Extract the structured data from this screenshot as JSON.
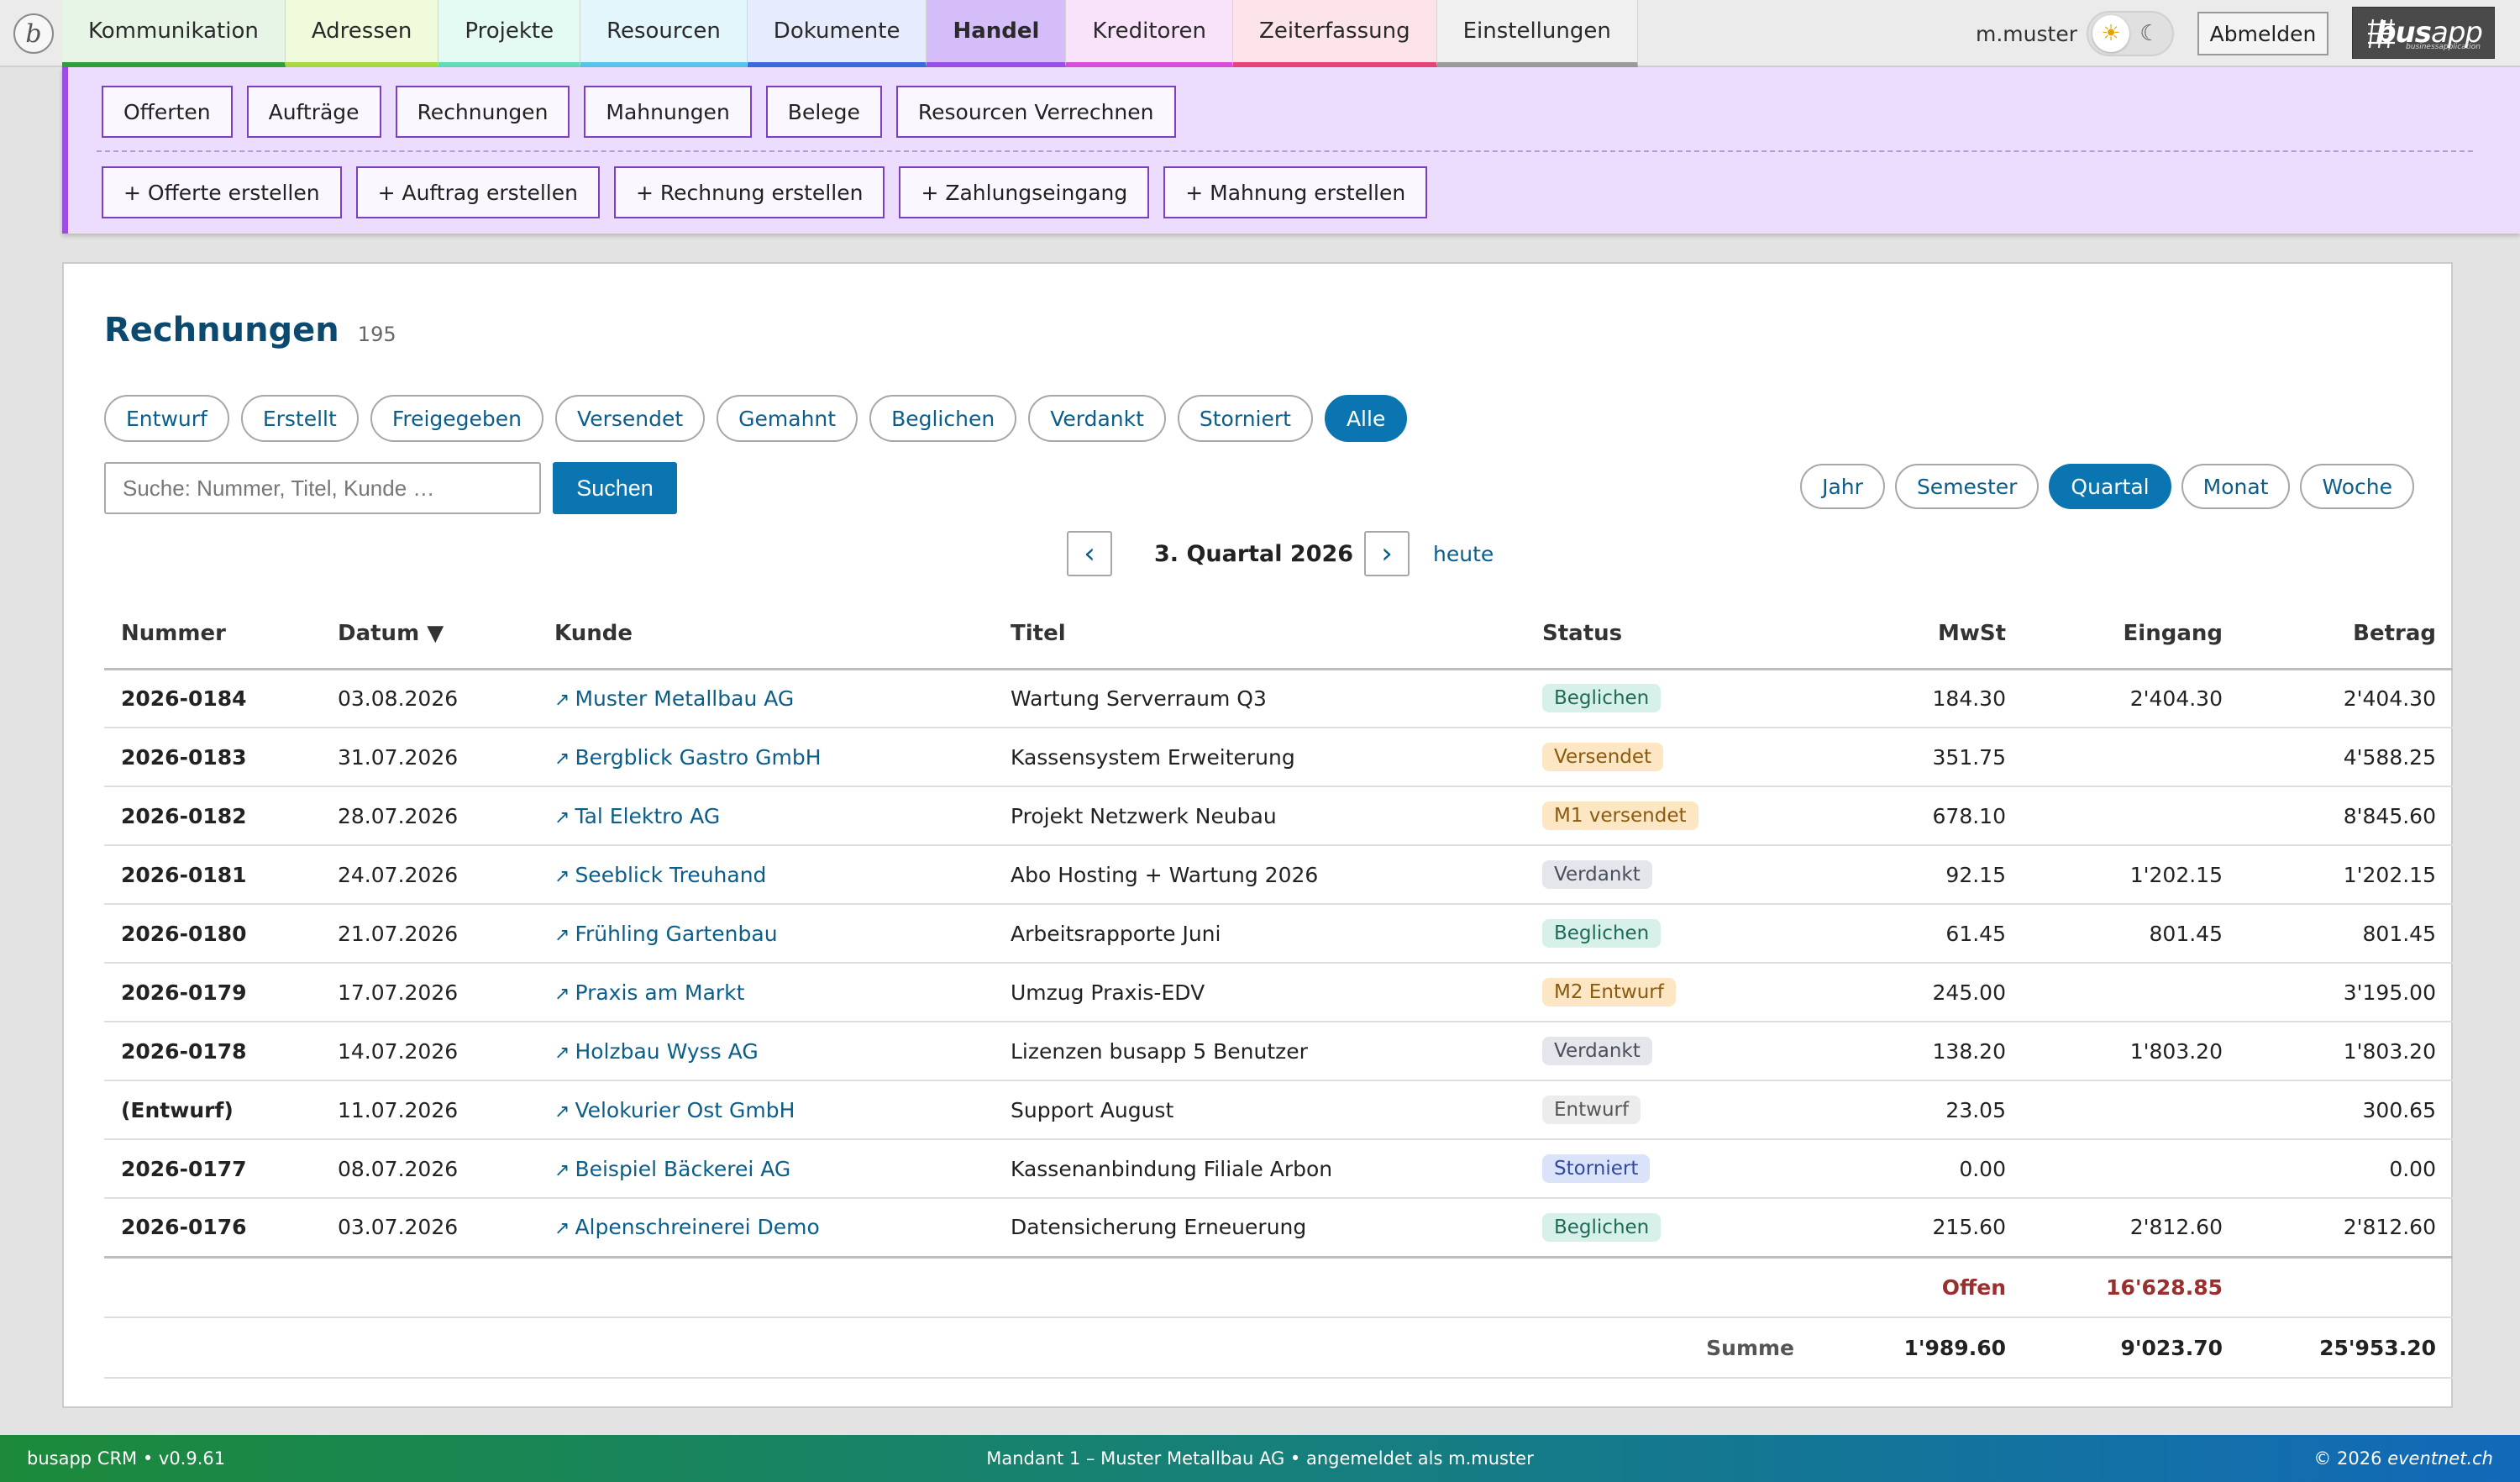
{
  "nav": {
    "logo_letter": "b",
    "tabs": [
      {
        "label": "Kommunikation",
        "color": "#e6f5e6",
        "accent": "#2e9e3f"
      },
      {
        "label": "Adressen",
        "color": "#f0fbdc",
        "accent": "#a5d93f"
      },
      {
        "label": "Projekte",
        "color": "#e3fbf3",
        "accent": "#5fdcb8"
      },
      {
        "label": "Resourcen",
        "color": "#e3f6fb",
        "accent": "#55c4e8"
      },
      {
        "label": "Dokumente",
        "color": "#e6ecfe",
        "accent": "#3a6ae0"
      },
      {
        "label": "Handel",
        "color": "#d4bdf8",
        "accent": "#9b4ee6"
      },
      {
        "label": "Kreditoren",
        "color": "#f9e3fb",
        "accent": "#d94ed9"
      },
      {
        "label": "Zeiterfassung",
        "color": "#fde4ea",
        "accent": "#e8437a"
      },
      {
        "label": "Einstellungen",
        "color": "#f0f0f0",
        "accent": "#9a9a9a"
      }
    ],
    "active_tab": "Handel",
    "user": "m.muster",
    "logout_label": "Abmelden",
    "brand": {
      "bold": "bus",
      "light": "app",
      "sub": "businessapplication"
    }
  },
  "subnav": {
    "row1": [
      "Offerten",
      "Aufträge",
      "Rechnungen",
      "Mahnungen",
      "Belege",
      "Resourcen Verrechnen"
    ],
    "row2": [
      "+ Offerte erstellen",
      "+ Auftrag erstellen",
      "+ Rechnung erstellen",
      "+ Zahlungseingang",
      "+ Mahnung erstellen"
    ]
  },
  "page": {
    "title": "Rechnungen",
    "count": "195"
  },
  "filters": {
    "status": [
      "Entwurf",
      "Erstellt",
      "Freigegeben",
      "Versendet",
      "Gemahnt",
      "Beglichen",
      "Verdankt",
      "Storniert",
      "Alle"
    ],
    "active_status": "Alle",
    "period": [
      "Jahr",
      "Semester",
      "Quartal",
      "Monat",
      "Woche"
    ],
    "active_period": "Quartal"
  },
  "search": {
    "placeholder": "Suche: Nummer, Titel, Kunde …",
    "value": "",
    "button": "Suchen"
  },
  "quarter_nav": {
    "prev": "‹",
    "label": "3. Quartal 2026",
    "next": "›",
    "today": "heute"
  },
  "table": {
    "columns": {
      "nummer": "Nummer",
      "datum": "Datum ▼",
      "kunde": "Kunde",
      "titel": "Titel",
      "status": "Status",
      "mwst": "MwSt",
      "eingang": "Eingang",
      "betrag": "Betrag"
    },
    "link_glyph": "↗",
    "rows": [
      {
        "nummer": "2026-0184",
        "datum": "03.08.2026",
        "kunde": "Muster Metallbau AG",
        "titel": "Wartung Serverraum Q3",
        "status": "Beglichen",
        "mwst": "184.30",
        "eingang": "2'404.30",
        "betrag": "2'404.30"
      },
      {
        "nummer": "2026-0183",
        "datum": "31.07.2026",
        "kunde": "Bergblick Gastro GmbH",
        "titel": "Kassensystem Erweiterung",
        "status": "Versendet",
        "mwst": "351.75",
        "eingang": "",
        "betrag": "4'588.25"
      },
      {
        "nummer": "2026-0182",
        "datum": "28.07.2026",
        "kunde": "Tal Elektro AG",
        "titel": "Projekt Netzwerk Neubau",
        "status": "M1 versendet",
        "mwst": "678.10",
        "eingang": "",
        "betrag": "8'845.60"
      },
      {
        "nummer": "2026-0181",
        "datum": "24.07.2026",
        "kunde": "Seeblick Treuhand",
        "titel": "Abo Hosting + Wartung 2026",
        "status": "Verdankt",
        "mwst": "92.15",
        "eingang": "1'202.15",
        "betrag": "1'202.15"
      },
      {
        "nummer": "2026-0180",
        "datum": "21.07.2026",
        "kunde": "Frühling Gartenbau",
        "titel": "Arbeitsrapporte Juni",
        "status": "Beglichen",
        "mwst": "61.45",
        "eingang": "801.45",
        "betrag": "801.45"
      },
      {
        "nummer": "2026-0179",
        "datum": "17.07.2026",
        "kunde": "Praxis am Markt",
        "titel": "Umzug Praxis-EDV",
        "status": "M2 Entwurf",
        "mwst": "245.00",
        "eingang": "",
        "betrag": "3'195.00"
      },
      {
        "nummer": "2026-0178",
        "datum": "14.07.2026",
        "kunde": "Holzbau Wyss AG",
        "titel": "Lizenzen busapp 5 Benutzer",
        "status": "Verdankt",
        "mwst": "138.20",
        "eingang": "1'803.20",
        "betrag": "1'803.20"
      },
      {
        "nummer": "(Entwurf)",
        "datum": "11.07.2026",
        "kunde": "Velokurier Ost GmbH",
        "titel": "Support August",
        "status": "Entwurf",
        "mwst": "23.05",
        "eingang": "",
        "betrag": "300.65"
      },
      {
        "nummer": "2026-0177",
        "datum": "08.07.2026",
        "kunde": "Beispiel Bäckerei AG",
        "titel": "Kassenanbindung Filiale Arbon",
        "status": "Storniert",
        "mwst": "0.00",
        "eingang": "",
        "betrag": "0.00"
      },
      {
        "nummer": "2026-0176",
        "datum": "03.07.2026",
        "kunde": "Alpenschreinerei Demo",
        "titel": "Datensicherung Erneuerung",
        "status": "Beglichen",
        "mwst": "215.60",
        "eingang": "2'812.60",
        "betrag": "2'812.60"
      }
    ],
    "status_colors": {
      "Beglichen": {
        "bg": "#d7f0ea",
        "fg": "#1f6b57"
      },
      "Versendet": {
        "bg": "#fde6c4",
        "fg": "#8a5a0f"
      },
      "M1 versendet": {
        "bg": "#fde6c4",
        "fg": "#8a5a0f"
      },
      "M2 Entwurf": {
        "bg": "#fde6c4",
        "fg": "#8a5a0f"
      },
      "Verdankt": {
        "bg": "#e4e6ec",
        "fg": "#4a4f5c"
      },
      "Entwurf": {
        "bg": "#ececec",
        "fg": "#555555"
      },
      "Storniert": {
        "bg": "#dbe3fb",
        "fg": "#2f4aa0"
      }
    },
    "offen": {
      "label": "Offen",
      "value": "16'628.85"
    },
    "summe": {
      "label": "Summe",
      "mwst": "1'989.60",
      "eingang": "9'023.70",
      "betrag": "25'953.20"
    }
  },
  "footer": {
    "left": "busapp CRM • v0.9.61",
    "center": "Mandant 1 – Muster Metallbau AG • angemeldet als m.muster",
    "right_prefix": "© 2026",
    "right_domain": "eventnet.ch"
  }
}
